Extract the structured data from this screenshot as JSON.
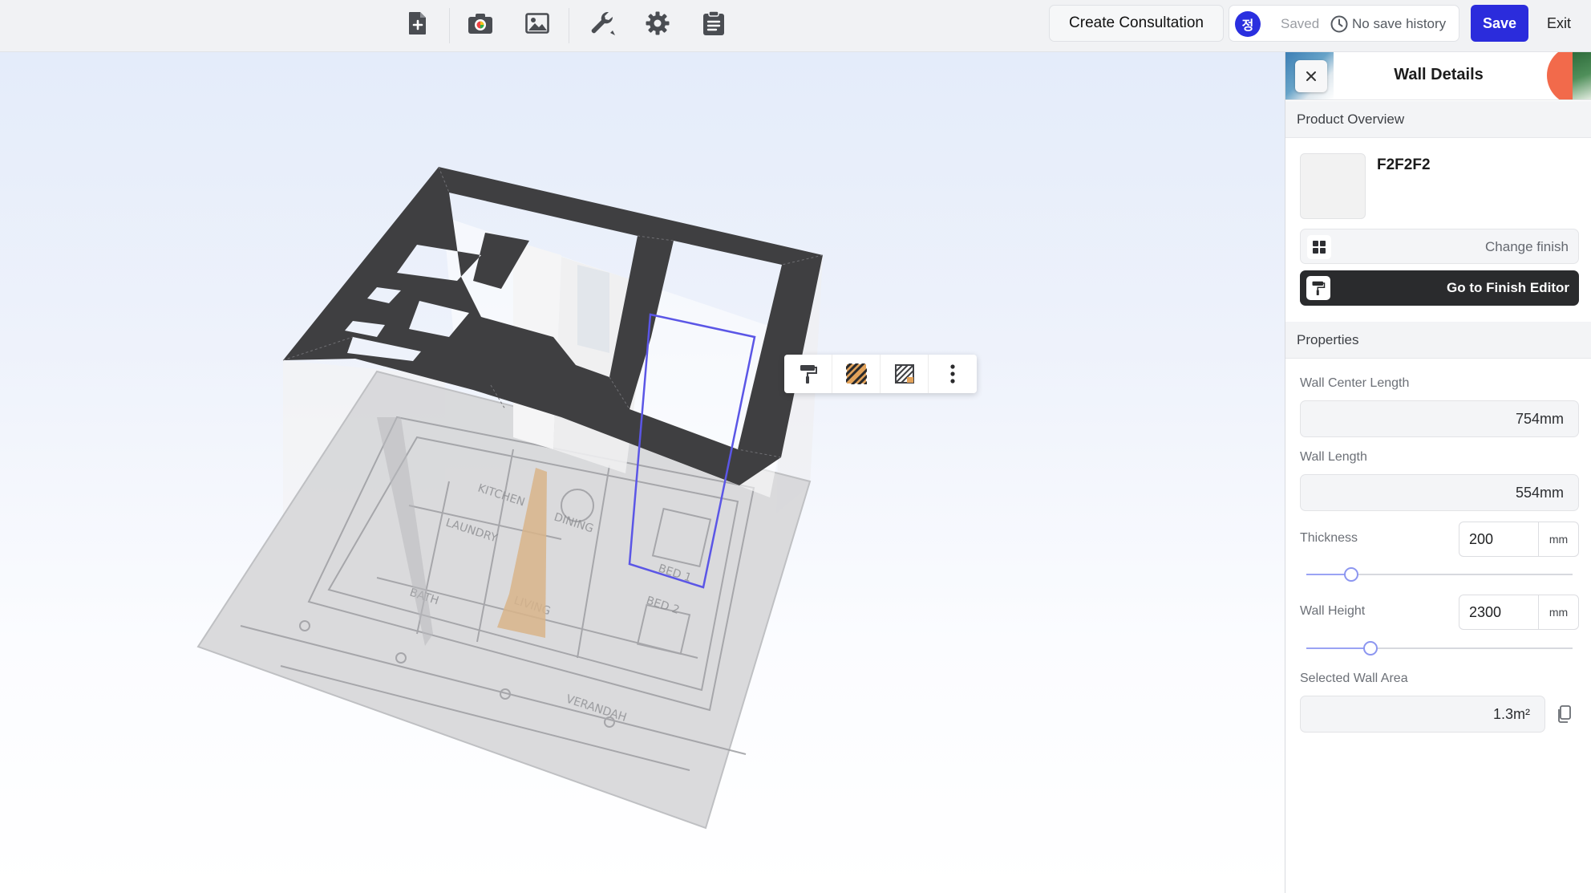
{
  "toolbar": {
    "tools": [
      {
        "name": "new-page-icon"
      },
      {
        "name": "camera-icon"
      },
      {
        "name": "image-icon"
      },
      {
        "name": "wrench-icon"
      },
      {
        "name": "gear-icon"
      },
      {
        "name": "clipboard-icon"
      }
    ],
    "create_consultation_label": "Create Consultation",
    "avatar_initial": "정",
    "saved_label": "Saved",
    "history_label": "No save history",
    "save_label": "Save",
    "exit_label": "Exit",
    "accent_color": "#2b2cdc"
  },
  "viewport": {
    "context_toolbar": [
      {
        "name": "paint-roller-icon"
      },
      {
        "name": "hatch-fill-icon"
      },
      {
        "name": "hatch-outline-icon"
      },
      {
        "name": "more-vertical-icon"
      }
    ]
  },
  "panel": {
    "title": "Wall Details",
    "product_overview_heading": "Product Overview",
    "finish_code": "F2F2F2",
    "finish_color": "#f2f2f2",
    "change_finish_label": "Change finish",
    "finish_editor_label": "Go to Finish Editor",
    "properties_heading": "Properties",
    "wall_center_length_label": "Wall Center Length",
    "wall_center_length_value": "754mm",
    "wall_length_label": "Wall Length",
    "wall_length_value": "554mm",
    "thickness_label": "Thickness",
    "thickness_value": "200",
    "thickness_unit": "mm",
    "thickness_slider_fraction": 0.17,
    "wall_height_label": "Wall Height",
    "wall_height_value": "2300",
    "wall_height_unit": "mm",
    "wall_height_slider_fraction": 0.24,
    "selected_wall_area_label": "Selected Wall Area",
    "selected_wall_area_value": "1.3m²"
  }
}
